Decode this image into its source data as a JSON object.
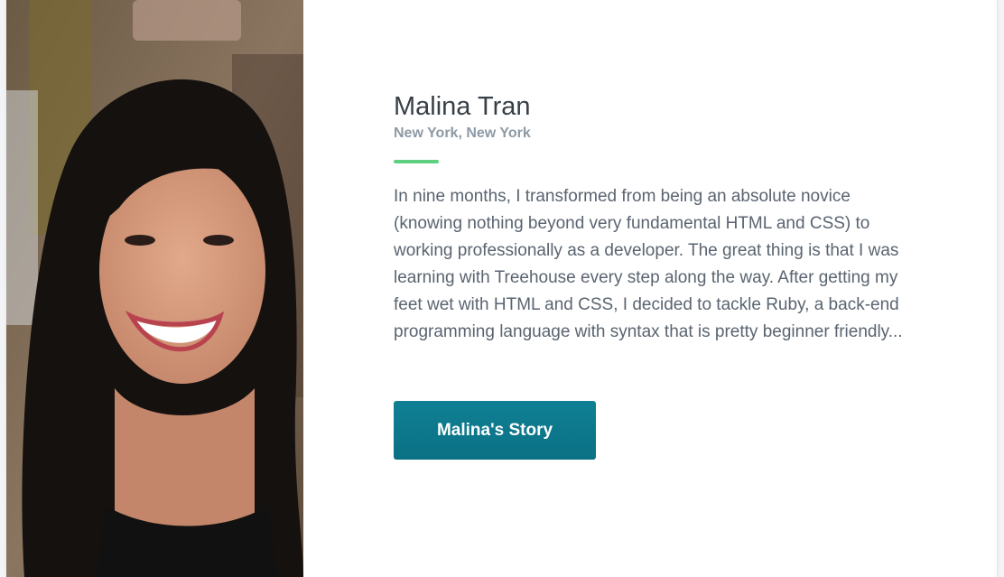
{
  "profile": {
    "name": "Malina Tran",
    "location": "New York, New York",
    "quote": "In nine months, I transformed from being an absolute novice (knowing nothing beyond very fundamental HTML and CSS) to working professionally as a developer. The great thing is that I was learning with Treehouse every step along the way. After getting my feet wet with HTML and CSS, I decided to tackle Ruby, a back-end programming language with syntax that is pretty beginner friendly...",
    "button_label": "Malina's Story"
  },
  "colors": {
    "accent_divider": "#5fcf80",
    "button": "#0b7a8e",
    "name_text": "#384047",
    "location_text": "#8d9aa5",
    "body_text": "#5a6470"
  }
}
